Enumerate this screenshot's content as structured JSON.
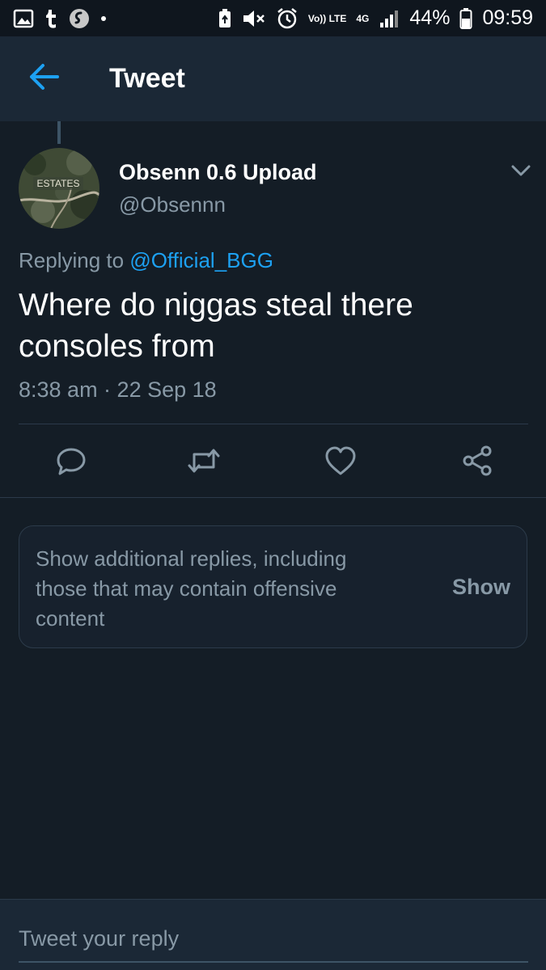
{
  "status_bar": {
    "battery_percent": "44%",
    "time": "09:59",
    "volte_label": "Vo)) LTE",
    "network_label": "4G",
    "left_icons": [
      "gallery-icon",
      "tumblr-icon",
      "shazam-icon",
      "dot-icon"
    ],
    "right_icons": [
      "battery-saver-icon",
      "mute-icon",
      "alarm-icon",
      "volte-icon",
      "network-4g-icon",
      "signal-icon",
      "battery-icon"
    ]
  },
  "header": {
    "title": "Tweet",
    "back_icon": "arrow-left-icon"
  },
  "tweet": {
    "avatar_text": "ESTATES",
    "display_name": "Obsenn 0.6 Upload",
    "handle": "@Obsennn",
    "replying_prefix": "Replying to",
    "replying_to": "@Official_BGG",
    "text": "Where do niggas steal there consoles from",
    "timestamp": "8:38 am · 22 Sep 18",
    "menu_icon": "chevron-down-icon"
  },
  "actions": [
    {
      "name": "reply",
      "icon": "reply-icon"
    },
    {
      "name": "retweet",
      "icon": "retweet-icon"
    },
    {
      "name": "like",
      "icon": "heart-icon"
    },
    {
      "name": "share",
      "icon": "share-icon"
    }
  ],
  "notice": {
    "text": "Show additional replies, including those that may contain offensive content",
    "button_label": "Show"
  },
  "reply_box": {
    "placeholder": "Tweet your reply"
  },
  "colors": {
    "background": "#141d26",
    "bar": "#1b2836",
    "accent": "#1da1f2",
    "secondary_text": "#8899a6"
  }
}
